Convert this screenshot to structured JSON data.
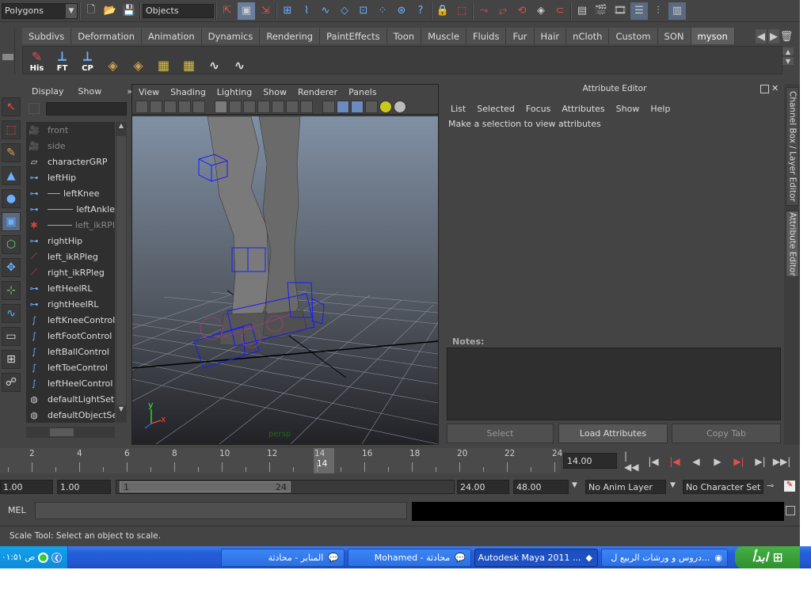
{
  "status_line": {
    "mode": "Polygons",
    "selection_mode_field": "Objects"
  },
  "shelf": {
    "tabs": [
      "Subdivs",
      "Deformation",
      "Animation",
      "Dynamics",
      "Rendering",
      "PaintEffects",
      "Toon",
      "Muscle",
      "Fluids",
      "Fur",
      "Hair",
      "nCloth",
      "Custom",
      "SON",
      "myson"
    ],
    "active_tab": "myson",
    "icons": [
      {
        "name": "history-icon",
        "label": "His"
      },
      {
        "name": "freeze-transform-icon",
        "label": "FT"
      },
      {
        "name": "center-pivot-icon",
        "label": "CP"
      },
      {
        "name": "shelf-tool-4-icon",
        "label": ""
      },
      {
        "name": "shelf-tool-5-icon",
        "label": ""
      },
      {
        "name": "shelf-tool-6-icon",
        "label": ""
      },
      {
        "name": "shelf-tool-7-icon",
        "label": ""
      },
      {
        "name": "shelf-tool-8-icon",
        "label": ""
      },
      {
        "name": "shelf-tool-9-icon",
        "label": ""
      }
    ]
  },
  "outliner": {
    "menu": [
      "Display",
      "Show"
    ],
    "items": [
      {
        "label": "front",
        "indent": 0,
        "dim": true,
        "icon": "camera-icon"
      },
      {
        "label": "side",
        "indent": 0,
        "dim": true,
        "icon": "camera-icon"
      },
      {
        "label": "characterGRP",
        "indent": 0,
        "dim": false,
        "icon": "group-icon"
      },
      {
        "label": "leftHip",
        "indent": 0,
        "dim": false,
        "icon": "joint-icon"
      },
      {
        "label": "leftKnee",
        "indent": 1,
        "dim": false,
        "icon": "joint-icon"
      },
      {
        "label": "leftAnkle",
        "indent": 2,
        "dim": false,
        "icon": "joint-icon"
      },
      {
        "label": "left_ikRPl",
        "indent": 2,
        "dim": true,
        "icon": "ik-effector-icon"
      },
      {
        "label": "rightHip",
        "indent": 0,
        "dim": false,
        "icon": "joint-icon"
      },
      {
        "label": "left_ikRPleg",
        "indent": 0,
        "dim": false,
        "icon": "ik-handle-icon"
      },
      {
        "label": "right_ikRPleg",
        "indent": 0,
        "dim": false,
        "icon": "ik-handle-icon"
      },
      {
        "label": "leftHeelRL",
        "indent": 0,
        "dim": false,
        "icon": "joint-icon"
      },
      {
        "label": "rightHeelRL",
        "indent": 0,
        "dim": false,
        "icon": "joint-icon"
      },
      {
        "label": "leftKneeControl",
        "indent": 0,
        "dim": false,
        "icon": "curve-icon"
      },
      {
        "label": "leftFootControl",
        "indent": 0,
        "dim": false,
        "icon": "curve-icon"
      },
      {
        "label": "leftBallControl",
        "indent": 0,
        "dim": false,
        "icon": "curve-icon"
      },
      {
        "label": "leftToeControl",
        "indent": 0,
        "dim": false,
        "icon": "curve-icon"
      },
      {
        "label": "leftHeelControl",
        "indent": 0,
        "dim": false,
        "icon": "curve-icon"
      },
      {
        "label": "defaultLightSet",
        "indent": 0,
        "dim": false,
        "icon": "set-icon"
      },
      {
        "label": "defaultObjectSet",
        "indent": 0,
        "dim": false,
        "icon": "set-icon"
      }
    ]
  },
  "viewport": {
    "menu": [
      "View",
      "Shading",
      "Lighting",
      "Show",
      "Renderer",
      "Panels"
    ],
    "camera_label": "persp",
    "axis_y": "y",
    "axis_x": "x"
  },
  "attribute_editor": {
    "title": "Attribute Editor",
    "menu": [
      "List",
      "Selected",
      "Focus",
      "Attributes",
      "Show",
      "Help"
    ],
    "message": "Make a selection to view attributes",
    "notes_label": "Notes:",
    "buttons": {
      "select": "Select",
      "load": "Load Attributes",
      "copy": "Copy Tab"
    }
  },
  "side_tabs": {
    "channel_box": "Channel Box / Layer Editor",
    "attribute_editor": "Attribute Editor"
  },
  "time_slider": {
    "labels": [
      "2",
      "4",
      "6",
      "8",
      "10",
      "12",
      "14",
      "16",
      "18",
      "20",
      "22",
      "24"
    ],
    "current_frame_label": "14",
    "current_frame_field": "14.00",
    "start": 1,
    "end": 24,
    "current": 14
  },
  "range_slider": {
    "start_time": "1.00",
    "playback_start": "1.00",
    "handle_start": "1",
    "handle_end": "24",
    "playback_end": "24.00",
    "end_time": "48.00",
    "anim_layer": "No Anim Layer",
    "character_set": "No Character Set"
  },
  "command_line": {
    "label": "MEL"
  },
  "help_line": "Scale Tool: Select an object to scale.",
  "taskbar": {
    "clock": "۰۱:۵۱ ص",
    "tasks": [
      {
        "label": "المنابر - محادثة",
        "active": false
      },
      {
        "label": "Mohamed - محادثة",
        "active": false
      },
      {
        "label": "Autodesk Maya 2011 ...",
        "active": true
      },
      {
        "label": "دروس و ورشات الربيع ل...",
        "active": false
      }
    ],
    "start_label": "ابدأ"
  },
  "colors": {
    "panel_bg": "#444444",
    "viewport_top": "#8090a4",
    "viewport_bottom": "#2a2a2e",
    "wire_blue": "#1a1aff",
    "taskbar_blue": "#245edb",
    "start_green": "#3a9a3a"
  }
}
